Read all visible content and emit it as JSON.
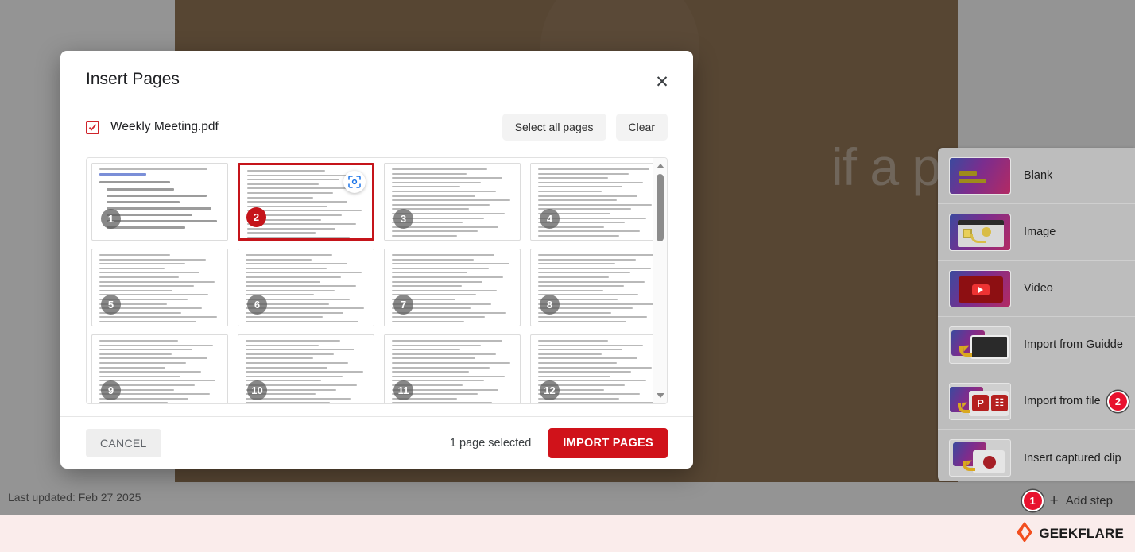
{
  "app": {
    "background_headline": "if a\np?",
    "status_bar": {
      "last_updated": "Last updated: Feb 27 2025",
      "add_step_label": "Add step",
      "add_step_badge": "1"
    },
    "collapse_arrow_icon": "chevron-left-icon"
  },
  "insert_panel": {
    "items": [
      {
        "label": "Blank",
        "icon": "blank-slide-icon",
        "badge": null
      },
      {
        "label": "Image",
        "icon": "image-slide-icon",
        "badge": null
      },
      {
        "label": "Video",
        "icon": "video-slide-icon",
        "badge": null
      },
      {
        "label": "Import from Guidde",
        "icon": "guidde-import-icon",
        "badge": null
      },
      {
        "label": "Import from file",
        "icon": "file-import-icon",
        "badge": "2"
      },
      {
        "label": "Insert captured clip",
        "icon": "captured-clip-icon",
        "badge": null
      }
    ]
  },
  "modal": {
    "title": "Insert Pages",
    "close_label": "✕",
    "file": {
      "name": "Weekly Meeting.pdf",
      "checked": true
    },
    "select_all_label": "Select all pages",
    "clear_label": "Clear",
    "pages": [
      {
        "number": "1",
        "selected": false
      },
      {
        "number": "2",
        "selected": true
      },
      {
        "number": "3",
        "selected": false
      },
      {
        "number": "4",
        "selected": false
      },
      {
        "number": "5",
        "selected": false
      },
      {
        "number": "6",
        "selected": false
      },
      {
        "number": "7",
        "selected": false
      },
      {
        "number": "8",
        "selected": false
      },
      {
        "number": "9",
        "selected": false
      },
      {
        "number": "10",
        "selected": false
      },
      {
        "number": "11",
        "selected": false
      },
      {
        "number": "12",
        "selected": false
      }
    ],
    "footer": {
      "cancel_label": "CANCEL",
      "selection_status": "1 page selected",
      "import_label": "IMPORT PAGES"
    }
  },
  "footer": {
    "brand": "GEEKFLARE"
  },
  "colors": {
    "accent_red": "#d0121a",
    "selected_border": "#c5141a",
    "badge_red": "#e8112d",
    "brown_panel": "#785228",
    "footer_bg": "#faeceb"
  }
}
